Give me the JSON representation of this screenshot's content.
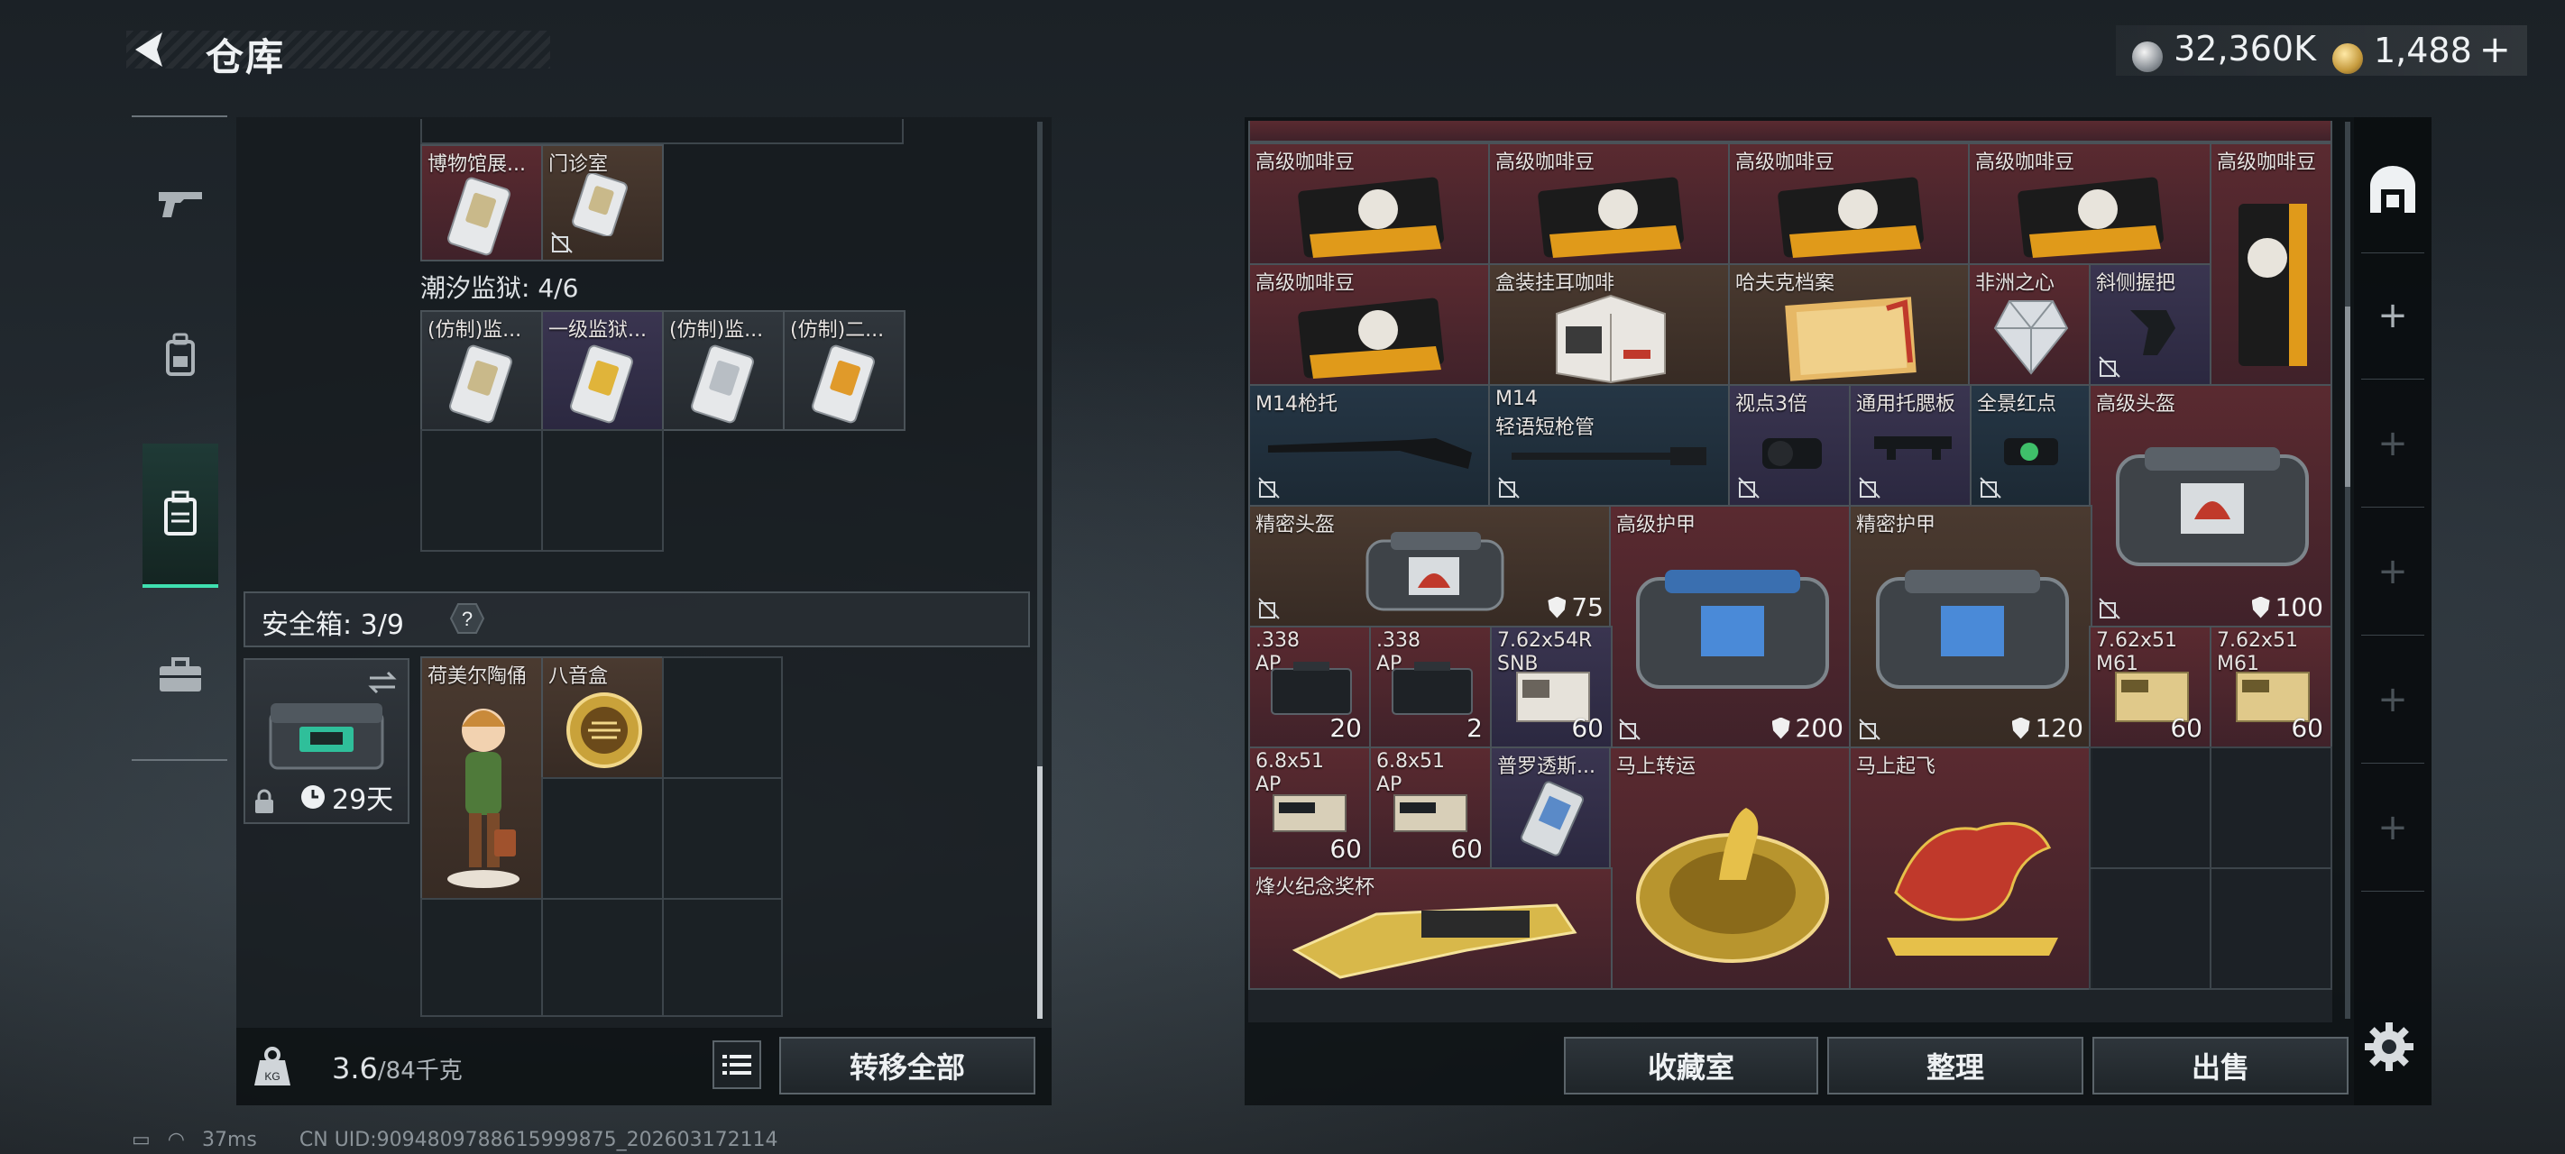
{
  "header": {
    "title": "仓库",
    "currency": [
      {
        "icon": "silver-coin-icon",
        "value": "32,360K"
      },
      {
        "icon": "gold-coin-icon",
        "value": "1,488"
      }
    ],
    "plus": "+"
  },
  "sidebar": {
    "items": [
      {
        "name": "weapons",
        "icon": "gun-icon",
        "active": false
      },
      {
        "name": "equipment",
        "icon": "backpack-icon",
        "active": false
      },
      {
        "name": "containers",
        "icon": "container-icon",
        "active": true
      },
      {
        "name": "toolbox",
        "icon": "briefcase-icon",
        "active": false
      }
    ]
  },
  "left": {
    "items_top": [
      {
        "name": "博物馆展..."
      },
      {
        "name": "门诊室"
      }
    ],
    "prison_label": "潮汐监狱: 4/6",
    "prison_items": [
      {
        "name": "(仿制)监..."
      },
      {
        "name": "一级监狱..."
      },
      {
        "name": "(仿制)监..."
      },
      {
        "name": "(仿制)二..."
      }
    ],
    "safebox_label": "安全箱: 3/9",
    "safebox_help": "?",
    "safebox": {
      "timer": "29天"
    },
    "safebox_items": [
      {
        "name": "荷美尔陶俑"
      },
      {
        "name": "八音盒"
      }
    ],
    "weight": "3.6",
    "weight_max": "/84千克",
    "transfer_all": "转移全部"
  },
  "right": {
    "items": [
      {
        "name": "高级咖啡豆",
        "color": "red"
      },
      {
        "name": "高级咖啡豆",
        "color": "red"
      },
      {
        "name": "高级咖啡豆",
        "color": "red"
      },
      {
        "name": "高级咖啡豆",
        "color": "red"
      },
      {
        "name": "高级咖啡豆",
        "color": "red"
      },
      {
        "name": "高级咖啡豆",
        "color": "red"
      },
      {
        "name": "盒装挂耳咖啡",
        "color": "brown"
      },
      {
        "name": "哈夫克档案",
        "color": "brown"
      },
      {
        "name": "非洲之心",
        "color": "red"
      },
      {
        "name": "斜侧握把",
        "color": "purple"
      },
      {
        "name": "M14枪托",
        "color": "blue"
      },
      {
        "name": "M14",
        "name2": "轻语短枪管",
        "color": "blue"
      },
      {
        "name": "视点3倍",
        "color": "purple"
      },
      {
        "name": "通用托腮板",
        "color": "purple"
      },
      {
        "name": "全景红点",
        "color": "blue"
      },
      {
        "name": "高级头盔",
        "color": "red",
        "durability": "100"
      },
      {
        "name": "精密头盔",
        "color": "brown",
        "durability": "75"
      },
      {
        "name": "高级护甲",
        "color": "red",
        "durability": "200"
      },
      {
        "name": "精密护甲",
        "color": "brown",
        "durability": "120"
      },
      {
        "name": ".338",
        "name2": "AP",
        "color": "red",
        "qty": "20"
      },
      {
        "name": ".338",
        "name2": "AP",
        "color": "red",
        "qty": "2"
      },
      {
        "name": "7.62x54R",
        "name2": "SNB",
        "color": "purple",
        "qty": "60"
      },
      {
        "name": "7.62x51",
        "name2": "M61",
        "color": "red",
        "qty": "60"
      },
      {
        "name": "7.62x51",
        "name2": "M61",
        "color": "red",
        "qty": "60"
      },
      {
        "name": "6.8x51",
        "name2": "AP",
        "color": "red",
        "qty": "60"
      },
      {
        "name": "6.8x51",
        "name2": "AP",
        "color": "red",
        "qty": "60"
      },
      {
        "name": "普罗透斯...",
        "color": "purple"
      },
      {
        "name": "马上转运",
        "color": "red"
      },
      {
        "name": "马上起飞",
        "color": "red"
      },
      {
        "name": "烽火纪念奖杯",
        "color": "red"
      }
    ],
    "buttons": {
      "collection": "收藏室",
      "sort": "整理",
      "sell": "出售"
    }
  },
  "rail": {
    "plus": "+"
  },
  "status": {
    "ping": "37ms",
    "uid": "CN UID:9094809788615999875_202603172114"
  }
}
